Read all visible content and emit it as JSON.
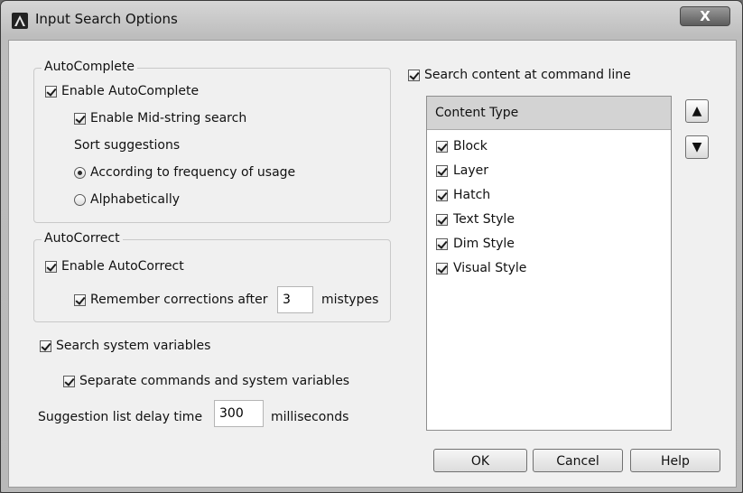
{
  "window": {
    "title": "Input Search Options",
    "close_glyph": "X"
  },
  "autocomplete": {
    "legend": "AutoComplete",
    "enable_label": "Enable AutoComplete",
    "midstring_label": "Enable Mid-string search",
    "sort_label": "Sort suggestions",
    "sort_options": [
      {
        "label": "According to frequency of usage",
        "selected": true
      },
      {
        "label": "Alphabetically",
        "selected": false
      }
    ]
  },
  "autocorrect": {
    "legend": "AutoCorrect",
    "enable_label": "Enable AutoCorrect",
    "remember_label": "Remember corrections after",
    "mistypes_value": "3",
    "mistypes_label": "mistypes"
  },
  "sysvars": {
    "search_label": "Search system variables",
    "separate_label": "Separate commands and system variables"
  },
  "delay": {
    "label": "Suggestion list delay time",
    "value": "300",
    "unit": "milliseconds"
  },
  "content": {
    "search_label": "Search content at command line",
    "header": "Content Type",
    "items": [
      "Block",
      "Layer",
      "Hatch",
      "Text Style",
      "Dim Style",
      "Visual Style"
    ],
    "up_glyph": "▲",
    "down_glyph": "▼"
  },
  "buttons": {
    "ok": "OK",
    "cancel": "Cancel",
    "help": "Help"
  }
}
